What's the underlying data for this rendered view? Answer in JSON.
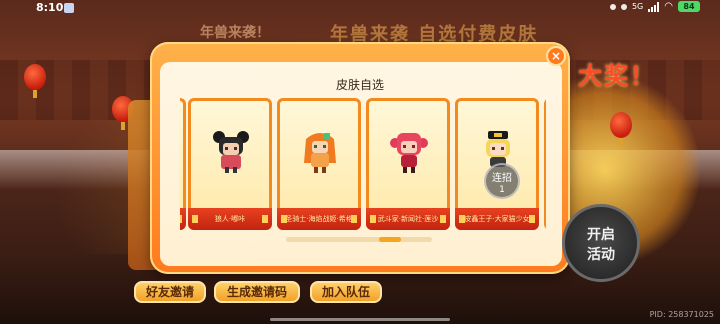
{
  "status_bar": {
    "time": "8:10",
    "network": "5G",
    "battery": "84"
  },
  "background": {
    "new_year_text": "年兽来袭！",
    "banner_text": "年兽来袭 自选付费皮肤",
    "big_prize_text": "大奖！"
  },
  "modal": {
    "title": "皮肤自选",
    "close_label": "×",
    "cards": [
      {
        "name": "狼人·嘟咔",
        "icon": "wolf-girl-sprite-icon"
      },
      {
        "name": "圣骑士·海焰战姬·希格",
        "icon": "flame-knight-sprite-icon"
      },
      {
        "name": "武斗家·新闻社·莲沙",
        "icon": "pink-fighter-sprite-icon"
      },
      {
        "name": "皮鑫王子·大家猫少女",
        "icon": "cat-girl-sprite-icon"
      }
    ],
    "combo": {
      "label": "连招",
      "count": "1"
    },
    "scroll_position": 0.75
  },
  "buttons": {
    "invite_friends": "好友邀请",
    "generate_code": "生成邀请码",
    "join_team": "加入队伍",
    "start_line1": "开启",
    "start_line2": "活动"
  },
  "footer": {
    "pid": "PID: 258371025"
  },
  "colors": {
    "modal_frame": "#ff8a24",
    "card_border": "#f28a1e",
    "label_red": "#d6301a",
    "accent_gold": "#ffd06a"
  }
}
